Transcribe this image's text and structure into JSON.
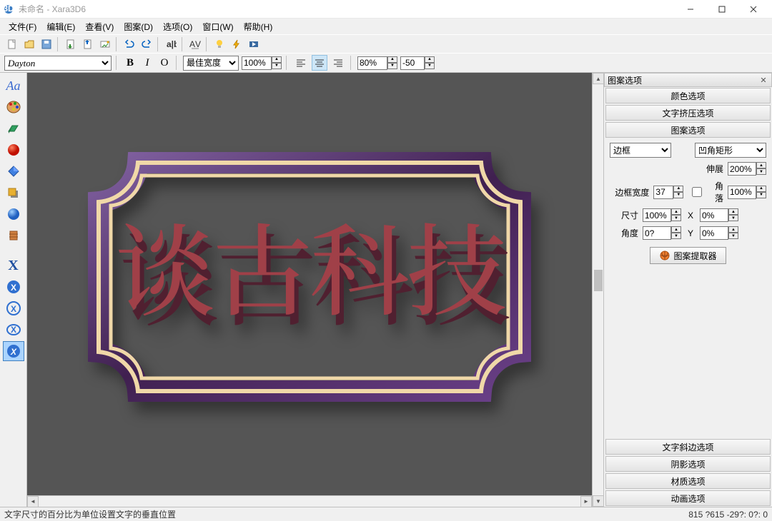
{
  "title": "未命名 - Xara3D6",
  "menu": {
    "file": "文件(F)",
    "edit": "编辑(E)",
    "view": "查看(V)",
    "design": "图案(D)",
    "options": "选项(O)",
    "window": "窗口(W)",
    "help": "帮助(H)"
  },
  "toolbar2": {
    "font": "Dayton",
    "widthMode": "最佳宽度",
    "zoom": "100%",
    "aspect": "80%",
    "baseline": "-50"
  },
  "panel": {
    "title": "图案选项",
    "acc": {
      "color": "颜色选项",
      "extrude": "文字挤压选项",
      "design": "图案选项",
      "bevel": "文字斜边选项",
      "shadow": "阴影选项",
      "material": "材质选项",
      "anim": "动画选项"
    },
    "borderType": "边框",
    "shapeType": "凹角矩形",
    "borderWidthLabel": "边框宽度",
    "borderWidth": "37",
    "stretchLabel": "伸展",
    "stretch": "200%",
    "cornerLabel": "角落",
    "corner": "100%",
    "sizeLabel": "尺寸",
    "size": "100%",
    "xLabel": "X",
    "xVal": "0%",
    "angleLabel": "角度",
    "angle": "0?",
    "yLabel": "Y",
    "yVal": "0%",
    "extractBtn": "图案提取器"
  },
  "canvasText": "谈古科技",
  "status": {
    "left": "文字尺寸的百分比为单位设置文字的垂直位置",
    "right": "815 ?615  -29?: 0?: 0"
  }
}
